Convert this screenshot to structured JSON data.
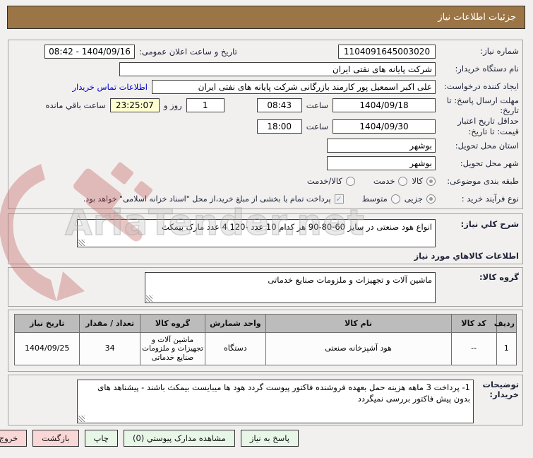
{
  "title_bar": {
    "title": "جزئیات اطلاعات نیاز"
  },
  "colors": {
    "title_bar_bg": "#9c7547",
    "link_blue": "#0000cc",
    "button_green": "#e7f6e7",
    "button_pink": "#f9d7d7",
    "timer_yellow": "#ffffd0",
    "table_header_gray": "#bcbcbc",
    "watermark_red": "#c0504d"
  },
  "form": {
    "need_number_label": "شماره نیاز:",
    "need_number_value": "1104091645003020",
    "announce_label": "تاریخ و ساعت اعلان عمومی:",
    "announce_value": "1404/09/16 - 08:42",
    "buyer_org_label": "نام دستگاه خریدار:",
    "buyer_org_value": "شرکت پایانه های نفتی ایران",
    "requester_label": "ایجاد کننده درخواست:",
    "requester_value": "علی اکبر اسمعیل پور کارمند بازرگانی شرکت پایانه های نفتی ایران",
    "contact_link": "اطلاعات تماس خریدار",
    "deadline_label": "مهلت ارسال پاسخ: تا تاریخ:",
    "deadline_date": "1404/09/18",
    "hour_label": "ساعت",
    "deadline_time": "08:43",
    "remaining_days": "1",
    "remaining_days_label": "روز و",
    "remaining_time": "23:25:07",
    "remaining_time_label": "ساعت باقي مانده",
    "validity_label": "حداقل تاریخ اعتبار قیمت: تا تاریخ:",
    "validity_date": "1404/09/30",
    "validity_time": "18:00",
    "province_label": "استان محل تحویل:",
    "province_value": "بوشهر",
    "city_label": "شهر محل تحویل:",
    "city_value": "بوشهر",
    "classification_label": "طبقه بندی موضوعی:",
    "classification_options": [
      {
        "label": "کالا",
        "selected": true
      },
      {
        "label": "خدمت",
        "selected": false
      },
      {
        "label": "کالا/خدمت",
        "selected": false
      }
    ],
    "process_label": "نوع فرآیند خرید :",
    "process_options": [
      {
        "label": "جزیی",
        "selected": true
      },
      {
        "label": "متوسط",
        "selected": false
      }
    ],
    "treasury_checkbox": {
      "checked": true,
      "label": "پرداخت تمام یا بخشی از مبلغ خرید،از محل \"اسناد خزانه اسلامی\" خواهد بود."
    }
  },
  "description": {
    "label": "شرح کلي نیاز:",
    "value": "انواع هود صنعتی در سایز 60-80-90 هر کدام 10 عدد -120 4 عدد  مارک بیمکث"
  },
  "goods_section": {
    "heading": "اطلاعات کالاهاي مورد نیاز",
    "group_label": "گروه کالا:",
    "group_value": "ماشین آلات و تجهیزات و ملزومات صنایع خدماتی"
  },
  "table": {
    "headers": [
      "ردیف",
      "کد کالا",
      "نام کالا",
      "واحد شمارش",
      "گروه کالا",
      "تعداد / مقدار",
      "تاریخ نیاز"
    ],
    "rows": [
      {
        "radif": "1",
        "code": "--",
        "name": "هود آشپزخانه صنعتی",
        "unit": "دستگاه",
        "group": "ماشین آلات و تجهیزات و ملزومات صنایع خدماتی",
        "qty": "34",
        "need_date": "1404/09/25"
      }
    ]
  },
  "notes": {
    "label": "توضیحات خریدار:",
    "value": "1- پرداخت 3 ماهه هزینه حمل بعهده فروشنده فاکتور پیوست گردد  هود ها میبایست بیمکث باشند - پیشناهد های بدون پیش فاکتور بررسی نمیگردد"
  },
  "buttons": [
    {
      "label": "پاسخ به نیاز",
      "style": "green"
    },
    {
      "label": "مشاهده مدارک پیوستي (0)",
      "style": "green"
    },
    {
      "label": "چاپ",
      "style": "green"
    },
    {
      "label": "بازگشت",
      "style": "pink"
    },
    {
      "label": "خروج",
      "style": "pink"
    }
  ],
  "watermark": {
    "text": "AriaTender.net"
  }
}
